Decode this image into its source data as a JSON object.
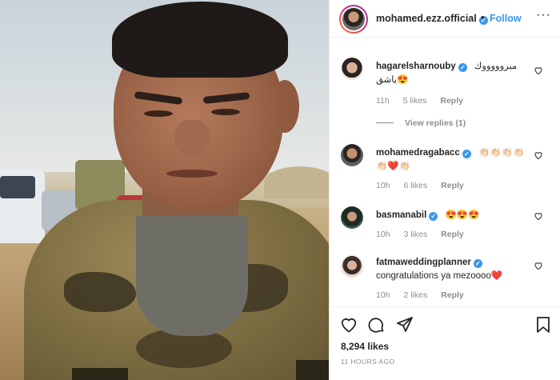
{
  "post": {
    "username": "mohamed.ezz.official",
    "separator": "•",
    "follow_label": "Follow",
    "more_label": "···",
    "likes": "8,294 likes",
    "time_ago": "11 HOURS AGO"
  },
  "comments": [
    {
      "username": "hagarelsharnouby",
      "text": "مبروووووك",
      "text_line2": "ياشق😍",
      "time": "11h",
      "likes": "5 likes",
      "reply_label": "Reply",
      "view_replies": "View replies (1)",
      "verified": true
    },
    {
      "username": "mohamedragabacc",
      "text": "👏🏻👏🏻👏🏻👏🏻",
      "text_line2": "👏🏻❤️👏🏻",
      "time": "10h",
      "likes": "6 likes",
      "reply_label": "Reply",
      "verified": true
    },
    {
      "username": "basmanabil",
      "text": "😍😍😍",
      "time": "10h",
      "likes": "3 likes",
      "reply_label": "Reply",
      "verified": true
    },
    {
      "username": "fatmaweddingplanner",
      "text": "congratulations ya mezoooo❤️",
      "time": "10h",
      "likes": "2 likes",
      "reply_label": "Reply",
      "verified": true
    }
  ],
  "icons": {
    "verified": "verified-badge-icon",
    "like": "heart-icon",
    "comment": "comment-icon",
    "share": "share-icon",
    "save": "bookmark-icon"
  },
  "colors": {
    "link": "#3897f0",
    "verified": "#3897f0",
    "muted": "#8e8e8e",
    "text": "#262626"
  }
}
